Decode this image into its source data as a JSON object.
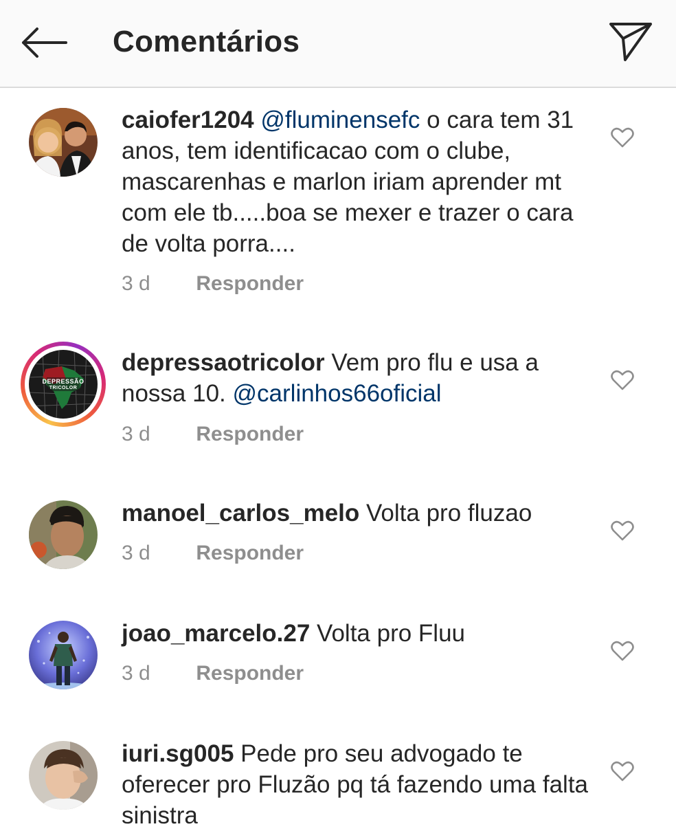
{
  "header": {
    "title": "Comentários",
    "back_icon": "arrow-left-icon",
    "share_icon": "paper-plane-icon"
  },
  "comments": [
    {
      "username": "caiofer1204",
      "mention": "@fluminensefc",
      "text": "o cara tem 31 anos, tem identificacao com o clube, mascarenhas e marlon iriam aprender mt com ele tb.....boa se mexer e trazer o cara de volta porra....",
      "time": "3 d",
      "reply_label": "Responder"
    },
    {
      "username": "depressaotricolor",
      "text": "Vem pro flu e usa a nossa 10.",
      "mention": "@carlinhos66oficial",
      "time": "3 d",
      "reply_label": "Responder",
      "avatar_logo_line1": "DEPRESSÃO",
      "avatar_logo_line2": "TRICOLOR"
    },
    {
      "username": "manoel_carlos_melo",
      "text": "Volta pro fluzao",
      "time": "3 d",
      "reply_label": "Responder"
    },
    {
      "username": "joao_marcelo.27",
      "text": "Volta pro Fluu",
      "time": "3 d",
      "reply_label": "Responder"
    },
    {
      "username": "iuri.sg005",
      "text": "Pede pro seu advogado te oferecer pro Fluzão pq tá fazendo uma falta sinistra"
    }
  ],
  "colors": {
    "text": "#262626",
    "muted": "#8e8e8e",
    "mention": "#003569",
    "header_bg": "#fafafa"
  }
}
